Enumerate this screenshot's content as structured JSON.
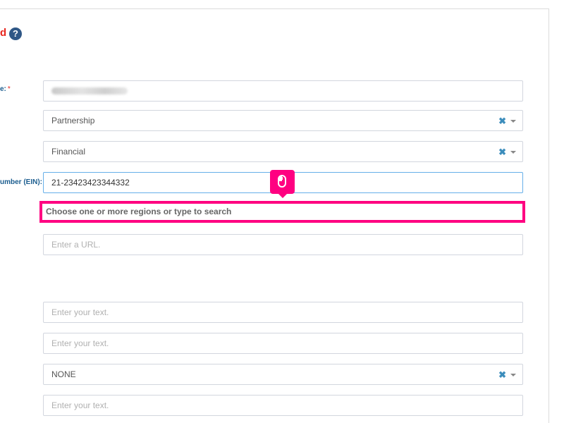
{
  "section": {
    "title": "d",
    "help_symbol": "?"
  },
  "fields": {
    "name": {
      "label_fragment": "e:",
      "required_mark": "*"
    },
    "entity_type": {
      "value": "Partnership",
      "clear_symbol": "✖"
    },
    "industry": {
      "value": "Financial",
      "clear_symbol": "✖"
    },
    "ein": {
      "label_fragment": "umber (EIN):",
      "value": "21-23423423344332"
    },
    "regions": {
      "placeholder": "Choose one or more regions or type to search"
    },
    "url": {
      "placeholder": "Enter a URL."
    },
    "text_1": {
      "placeholder": "Enter your text."
    },
    "text_2": {
      "placeholder": "Enter your text."
    },
    "option_select": {
      "value": "NONE",
      "clear_symbol": "✖"
    },
    "text_3": {
      "placeholder": "Enter your text."
    }
  },
  "colors": {
    "highlight": "#ff0081",
    "label": "#1b5d8f",
    "required": "#e8261e",
    "clear_icon": "#3c8dbc"
  },
  "icons": {
    "help": "help-icon",
    "clear": "clear-icon",
    "caret": "caret-down-icon",
    "cursor": "mouse-icon"
  }
}
